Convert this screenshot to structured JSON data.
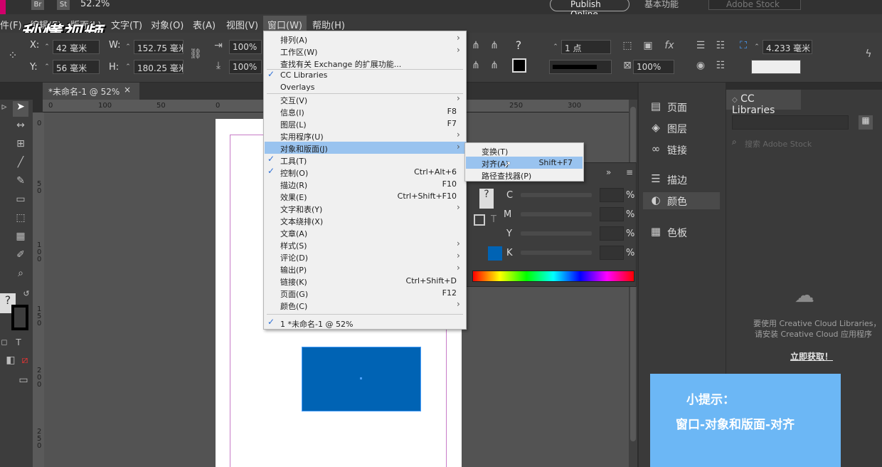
{
  "topbar": {
    "zoom": "52.2%",
    "publish_online": "Publish Online",
    "workspace": "基本功能",
    "search_placeholder": "Adobe Stock",
    "br": "Br",
    "st": "St"
  },
  "menubar": {
    "items": [
      "件(F)",
      "编辑(E)",
      "版面(L)",
      "文字(T)",
      "对象(O)",
      "表(A)",
      "视图(V)",
      "窗口(W)",
      "帮助(H)"
    ]
  },
  "watermark": "秒懂视频",
  "control": {
    "x_label": "X:",
    "x_value": "42 毫米",
    "y_label": "Y:",
    "y_value": "56 毫米",
    "w_label": "W:",
    "w_value": "152.75 毫米",
    "h_label": "H:",
    "h_value": "180.25 毫米",
    "scale_x": "100%",
    "scale_y": "100%",
    "stroke_weight": "1 点",
    "opacity": "100%",
    "offset": "4.233 毫米"
  },
  "document": {
    "tab_title": "*未命名-1 @ 52%",
    "ruler_h": [
      "0",
      "100",
      "50",
      "0",
      "250",
      "300"
    ],
    "ruler_v": [
      "0",
      "5 0",
      "1 0 0",
      "1 5 0",
      "2 0 0",
      "2 5 0"
    ]
  },
  "window_menu": {
    "items": [
      {
        "label": "排列(A)",
        "shortcut": "",
        "checked": false,
        "submenu": true
      },
      {
        "label": "工作区(W)",
        "shortcut": "",
        "checked": false,
        "submenu": true
      },
      {
        "label": "查找有关 Exchange 的扩展功能...",
        "shortcut": "",
        "checked": false,
        "submenu": false
      },
      {
        "label": "CC Libraries",
        "shortcut": "",
        "checked": true,
        "submenu": false
      },
      {
        "label": "Overlays",
        "shortcut": "",
        "checked": false,
        "submenu": false
      },
      {
        "label": "交互(V)",
        "shortcut": "",
        "checked": false,
        "submenu": true
      },
      {
        "label": "信息(I)",
        "shortcut": "F8",
        "checked": false,
        "submenu": false
      },
      {
        "label": "图层(L)",
        "shortcut": "F7",
        "checked": false,
        "submenu": false
      },
      {
        "label": "实用程序(U)",
        "shortcut": "",
        "checked": false,
        "submenu": true
      },
      {
        "label": "对象和版面(J)",
        "shortcut": "",
        "checked": false,
        "submenu": true,
        "highlighted": true
      },
      {
        "label": "工具(T)",
        "shortcut": "",
        "checked": true,
        "submenu": false
      },
      {
        "label": "控制(O)",
        "shortcut": "Ctrl+Alt+6",
        "checked": true,
        "submenu": false
      },
      {
        "label": "描边(R)",
        "shortcut": "F10",
        "checked": false,
        "submenu": false
      },
      {
        "label": "效果(E)",
        "shortcut": "Ctrl+Shift+F10",
        "checked": false,
        "submenu": false
      },
      {
        "label": "文字和表(Y)",
        "shortcut": "",
        "checked": false,
        "submenu": true
      },
      {
        "label": "文本绕排(X)",
        "shortcut": "",
        "checked": false,
        "submenu": false
      },
      {
        "label": "文章(A)",
        "shortcut": "",
        "checked": false,
        "submenu": false
      },
      {
        "label": "样式(S)",
        "shortcut": "",
        "checked": false,
        "submenu": true
      },
      {
        "label": "评论(D)",
        "shortcut": "",
        "checked": false,
        "submenu": true
      },
      {
        "label": "输出(P)",
        "shortcut": "",
        "checked": false,
        "submenu": true
      },
      {
        "label": "链接(K)",
        "shortcut": "Ctrl+Shift+D",
        "checked": false,
        "submenu": false
      },
      {
        "label": "页面(G)",
        "shortcut": "F12",
        "checked": false,
        "submenu": false
      },
      {
        "label": "颜色(C)",
        "shortcut": "",
        "checked": false,
        "submenu": true
      }
    ],
    "open_doc": "1 *未命名-1 @ 52%"
  },
  "submenu": {
    "items": [
      {
        "label": "变换(T)",
        "shortcut": ""
      },
      {
        "label": "对齐(A)",
        "shortcut": "Shift+F7",
        "highlighted": true
      },
      {
        "label": "路径查找器(P)",
        "shortcut": ""
      }
    ]
  },
  "color_panel": {
    "channels": [
      "C",
      "M",
      "Y",
      "K"
    ],
    "pct": "%"
  },
  "dock": {
    "items": [
      "页面",
      "图层",
      "链接",
      "描边",
      "颜色",
      "色板"
    ]
  },
  "libraries": {
    "title": "CC Libraries",
    "search_placeholder": "搜索 Adobe Stock",
    "msg1": "要使用 Creative Cloud Libraries，",
    "msg2": "请安装 Creative Cloud 应用程序",
    "link": "立即获取！"
  },
  "tip": {
    "line1": "小提示：",
    "line2": "窗口-对象和版面-对齐"
  },
  "colors": {
    "menu_highlight": "#99c3ef",
    "object_fill": "#0063b4",
    "tip_bg": "#6cb7f5"
  }
}
